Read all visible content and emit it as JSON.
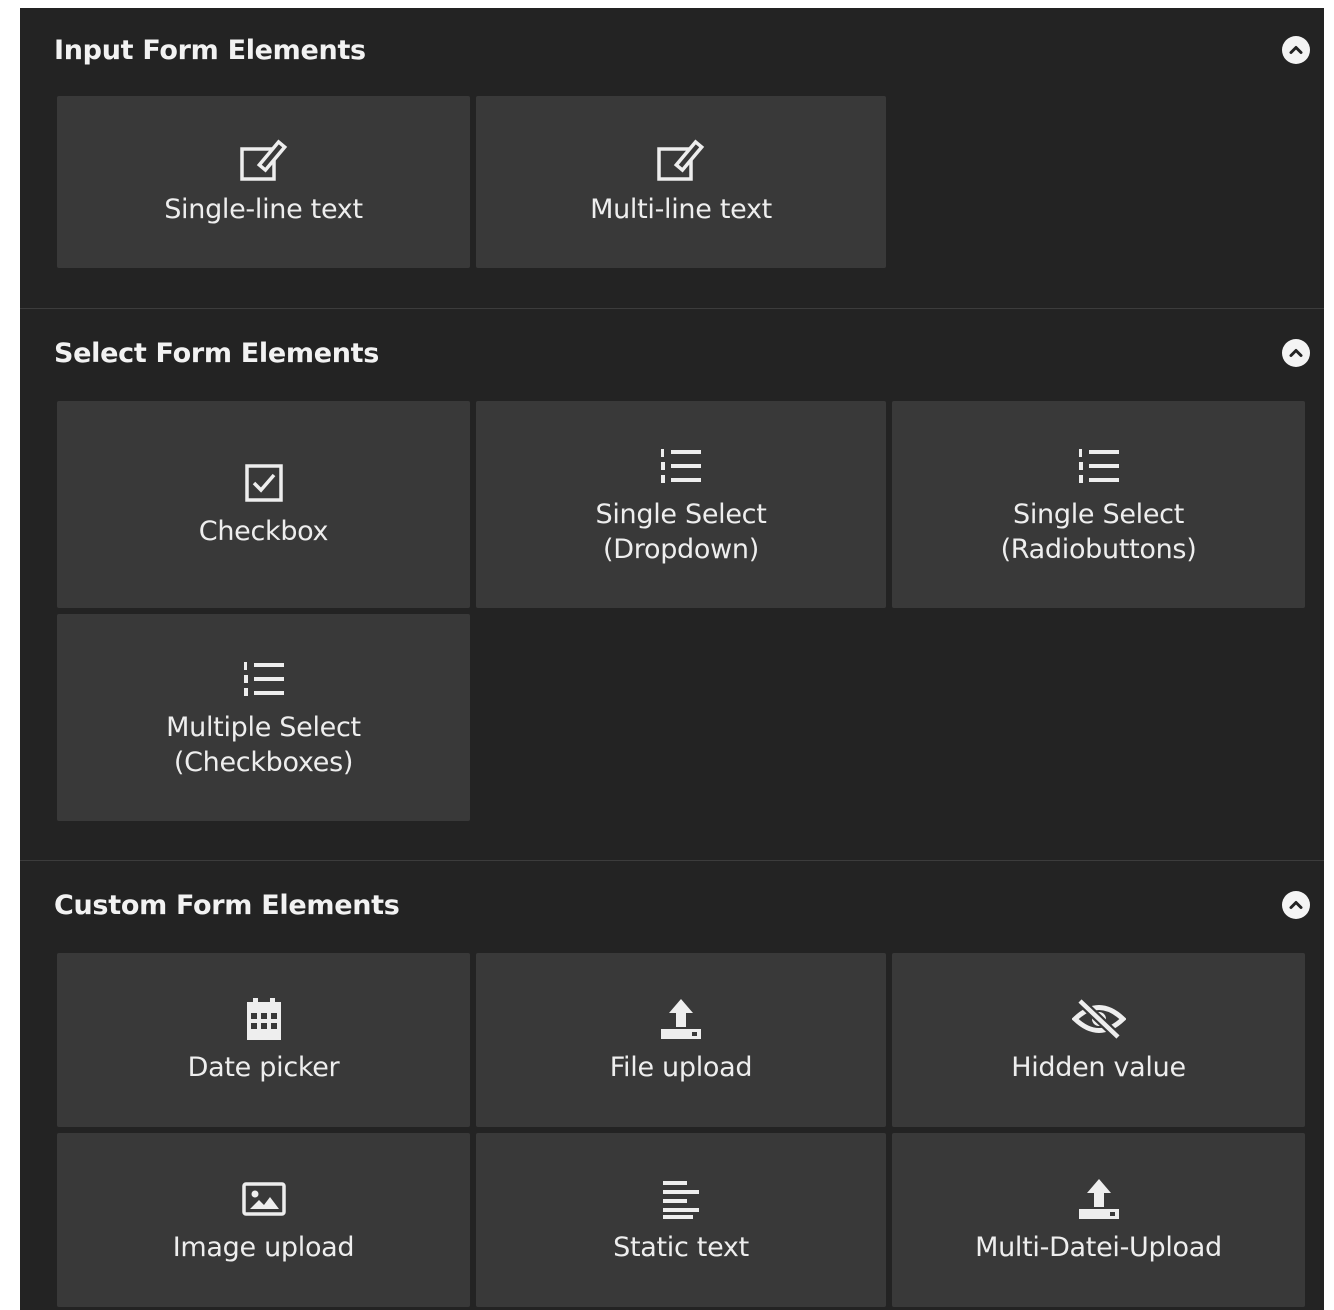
{
  "sections": [
    {
      "title": "Input Form Elements",
      "collapse_icon": "chevron-up-circle-icon",
      "items": [
        {
          "label": "Single-line text",
          "icon": "edit-icon"
        },
        {
          "label": "Multi-line text",
          "icon": "edit-icon"
        }
      ]
    },
    {
      "title": "Select Form Elements",
      "collapse_icon": "chevron-up-circle-icon",
      "items": [
        {
          "label": "Checkbox",
          "icon": "checkbox-icon"
        },
        {
          "label_line1": "Single Select",
          "label_line2": "(Dropdown)",
          "icon": "numbered-list-icon"
        },
        {
          "label_line1": "Single Select",
          "label_line2": "(Radiobuttons)",
          "icon": "numbered-list-icon"
        },
        {
          "label_line1": "Multiple Select",
          "label_line2": "(Checkboxes)",
          "icon": "numbered-list-icon"
        }
      ]
    },
    {
      "title": "Custom Form Elements",
      "collapse_icon": "chevron-up-circle-icon",
      "items": [
        {
          "label": "Date picker",
          "icon": "calendar-icon"
        },
        {
          "label": "File upload",
          "icon": "upload-icon"
        },
        {
          "label": "Hidden value",
          "icon": "eye-slash-icon"
        },
        {
          "label": "Image upload",
          "icon": "image-icon"
        },
        {
          "label": "Static text",
          "icon": "align-left-icon"
        },
        {
          "label": "Multi-Datei-Upload",
          "icon": "upload-icon"
        }
      ]
    }
  ],
  "colors": {
    "panel_bg": "#232323",
    "tile_bg": "#393939",
    "text": "#eeeeee"
  }
}
